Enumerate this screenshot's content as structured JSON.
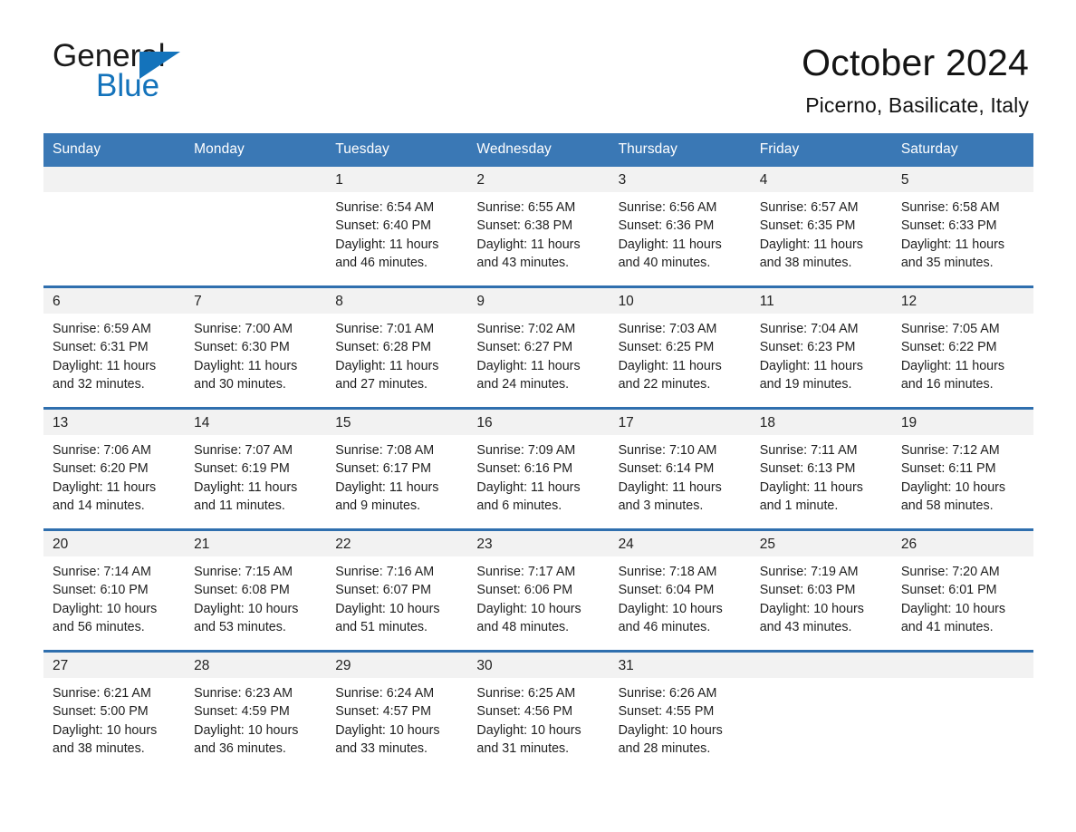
{
  "logo": {
    "word1": "General",
    "word2": "Blue",
    "triangle_color": "#1473bb"
  },
  "header": {
    "title": "October 2024",
    "subtitle": "Picerno, Basilicate, Italy"
  },
  "theme": {
    "header_blue": "#3a78b5",
    "row_border_blue": "#2f6fae",
    "day_band_gray": "#f2f2f2",
    "text_color": "#1f1f1f"
  },
  "weekdays": [
    "Sunday",
    "Monday",
    "Tuesday",
    "Wednesday",
    "Thursday",
    "Friday",
    "Saturday"
  ],
  "weeks": [
    [
      {
        "day": "",
        "sunrise": "",
        "sunset": "",
        "daylight": "",
        "empty": true
      },
      {
        "day": "",
        "sunrise": "",
        "sunset": "",
        "daylight": "",
        "empty": true
      },
      {
        "day": "1",
        "sunrise": "Sunrise: 6:54 AM",
        "sunset": "Sunset: 6:40 PM",
        "daylight": "Daylight: 11 hours and 46 minutes."
      },
      {
        "day": "2",
        "sunrise": "Sunrise: 6:55 AM",
        "sunset": "Sunset: 6:38 PM",
        "daylight": "Daylight: 11 hours and 43 minutes."
      },
      {
        "day": "3",
        "sunrise": "Sunrise: 6:56 AM",
        "sunset": "Sunset: 6:36 PM",
        "daylight": "Daylight: 11 hours and 40 minutes."
      },
      {
        "day": "4",
        "sunrise": "Sunrise: 6:57 AM",
        "sunset": "Sunset: 6:35 PM",
        "daylight": "Daylight: 11 hours and 38 minutes."
      },
      {
        "day": "5",
        "sunrise": "Sunrise: 6:58 AM",
        "sunset": "Sunset: 6:33 PM",
        "daylight": "Daylight: 11 hours and 35 minutes."
      }
    ],
    [
      {
        "day": "6",
        "sunrise": "Sunrise: 6:59 AM",
        "sunset": "Sunset: 6:31 PM",
        "daylight": "Daylight: 11 hours and 32 minutes."
      },
      {
        "day": "7",
        "sunrise": "Sunrise: 7:00 AM",
        "sunset": "Sunset: 6:30 PM",
        "daylight": "Daylight: 11 hours and 30 minutes."
      },
      {
        "day": "8",
        "sunrise": "Sunrise: 7:01 AM",
        "sunset": "Sunset: 6:28 PM",
        "daylight": "Daylight: 11 hours and 27 minutes."
      },
      {
        "day": "9",
        "sunrise": "Sunrise: 7:02 AM",
        "sunset": "Sunset: 6:27 PM",
        "daylight": "Daylight: 11 hours and 24 minutes."
      },
      {
        "day": "10",
        "sunrise": "Sunrise: 7:03 AM",
        "sunset": "Sunset: 6:25 PM",
        "daylight": "Daylight: 11 hours and 22 minutes."
      },
      {
        "day": "11",
        "sunrise": "Sunrise: 7:04 AM",
        "sunset": "Sunset: 6:23 PM",
        "daylight": "Daylight: 11 hours and 19 minutes."
      },
      {
        "day": "12",
        "sunrise": "Sunrise: 7:05 AM",
        "sunset": "Sunset: 6:22 PM",
        "daylight": "Daylight: 11 hours and 16 minutes."
      }
    ],
    [
      {
        "day": "13",
        "sunrise": "Sunrise: 7:06 AM",
        "sunset": "Sunset: 6:20 PM",
        "daylight": "Daylight: 11 hours and 14 minutes."
      },
      {
        "day": "14",
        "sunrise": "Sunrise: 7:07 AM",
        "sunset": "Sunset: 6:19 PM",
        "daylight": "Daylight: 11 hours and 11 minutes."
      },
      {
        "day": "15",
        "sunrise": "Sunrise: 7:08 AM",
        "sunset": "Sunset: 6:17 PM",
        "daylight": "Daylight: 11 hours and 9 minutes."
      },
      {
        "day": "16",
        "sunrise": "Sunrise: 7:09 AM",
        "sunset": "Sunset: 6:16 PM",
        "daylight": "Daylight: 11 hours and 6 minutes."
      },
      {
        "day": "17",
        "sunrise": "Sunrise: 7:10 AM",
        "sunset": "Sunset: 6:14 PM",
        "daylight": "Daylight: 11 hours and 3 minutes."
      },
      {
        "day": "18",
        "sunrise": "Sunrise: 7:11 AM",
        "sunset": "Sunset: 6:13 PM",
        "daylight": "Daylight: 11 hours and 1 minute."
      },
      {
        "day": "19",
        "sunrise": "Sunrise: 7:12 AM",
        "sunset": "Sunset: 6:11 PM",
        "daylight": "Daylight: 10 hours and 58 minutes."
      }
    ],
    [
      {
        "day": "20",
        "sunrise": "Sunrise: 7:14 AM",
        "sunset": "Sunset: 6:10 PM",
        "daylight": "Daylight: 10 hours and 56 minutes."
      },
      {
        "day": "21",
        "sunrise": "Sunrise: 7:15 AM",
        "sunset": "Sunset: 6:08 PM",
        "daylight": "Daylight: 10 hours and 53 minutes."
      },
      {
        "day": "22",
        "sunrise": "Sunrise: 7:16 AM",
        "sunset": "Sunset: 6:07 PM",
        "daylight": "Daylight: 10 hours and 51 minutes."
      },
      {
        "day": "23",
        "sunrise": "Sunrise: 7:17 AM",
        "sunset": "Sunset: 6:06 PM",
        "daylight": "Daylight: 10 hours and 48 minutes."
      },
      {
        "day": "24",
        "sunrise": "Sunrise: 7:18 AM",
        "sunset": "Sunset: 6:04 PM",
        "daylight": "Daylight: 10 hours and 46 minutes."
      },
      {
        "day": "25",
        "sunrise": "Sunrise: 7:19 AM",
        "sunset": "Sunset: 6:03 PM",
        "daylight": "Daylight: 10 hours and 43 minutes."
      },
      {
        "day": "26",
        "sunrise": "Sunrise: 7:20 AM",
        "sunset": "Sunset: 6:01 PM",
        "daylight": "Daylight: 10 hours and 41 minutes."
      }
    ],
    [
      {
        "day": "27",
        "sunrise": "Sunrise: 6:21 AM",
        "sunset": "Sunset: 5:00 PM",
        "daylight": "Daylight: 10 hours and 38 minutes."
      },
      {
        "day": "28",
        "sunrise": "Sunrise: 6:23 AM",
        "sunset": "Sunset: 4:59 PM",
        "daylight": "Daylight: 10 hours and 36 minutes."
      },
      {
        "day": "29",
        "sunrise": "Sunrise: 6:24 AM",
        "sunset": "Sunset: 4:57 PM",
        "daylight": "Daylight: 10 hours and 33 minutes."
      },
      {
        "day": "30",
        "sunrise": "Sunrise: 6:25 AM",
        "sunset": "Sunset: 4:56 PM",
        "daylight": "Daylight: 10 hours and 31 minutes."
      },
      {
        "day": "31",
        "sunrise": "Sunrise: 6:26 AM",
        "sunset": "Sunset: 4:55 PM",
        "daylight": "Daylight: 10 hours and 28 minutes."
      },
      {
        "day": "",
        "sunrise": "",
        "sunset": "",
        "daylight": "",
        "empty": true
      },
      {
        "day": "",
        "sunrise": "",
        "sunset": "",
        "daylight": "",
        "empty": true
      }
    ]
  ]
}
